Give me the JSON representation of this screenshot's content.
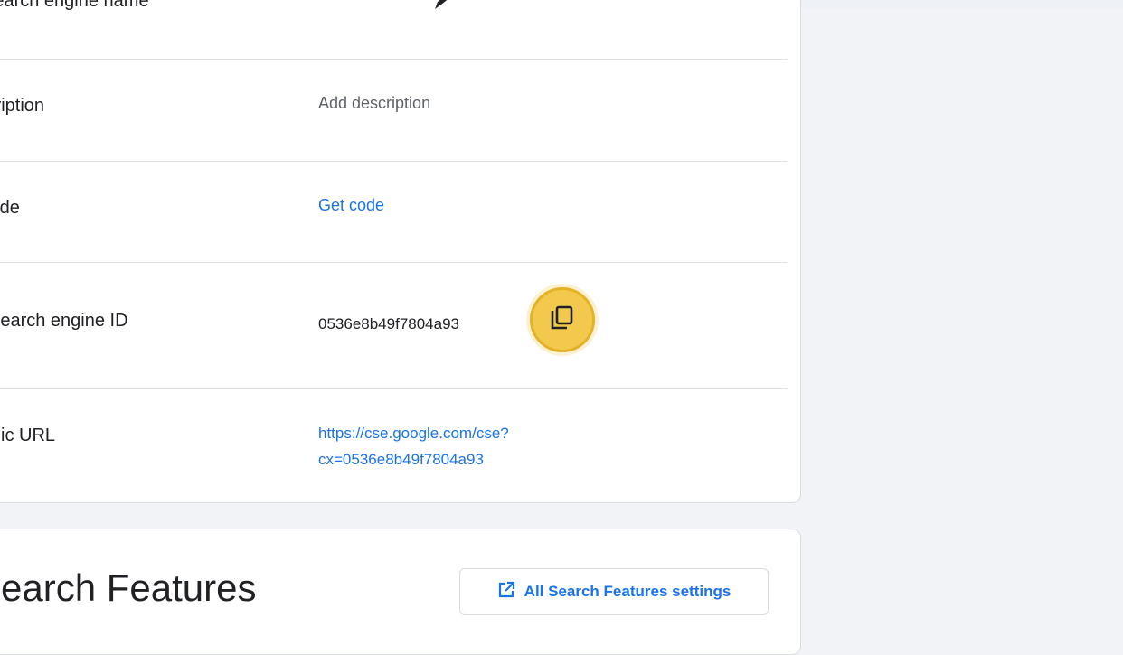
{
  "details": {
    "rows": [
      {
        "label": "Search engine name",
        "value": ""
      },
      {
        "label": "Description",
        "value": "Add description"
      },
      {
        "label": "Code",
        "value": "Get code"
      },
      {
        "label": "Search engine ID",
        "value": "0536e8b49f7804a93"
      },
      {
        "label": "Public URL",
        "value_line1": "https://cse.google.com/cse?",
        "value_line2": "cx=0536e8b49f7804a93"
      }
    ]
  },
  "features": {
    "title": "Search Features",
    "settings_button_label": "All Search Features settings"
  },
  "colors": {
    "link": "#1a73e8",
    "highlight": "#f2c94c",
    "text": "#202124",
    "muted": "#5f6368"
  },
  "icons": {
    "edit": "pencil-icon",
    "copy": "copy-icon",
    "open_external": "open-in-new-icon"
  }
}
